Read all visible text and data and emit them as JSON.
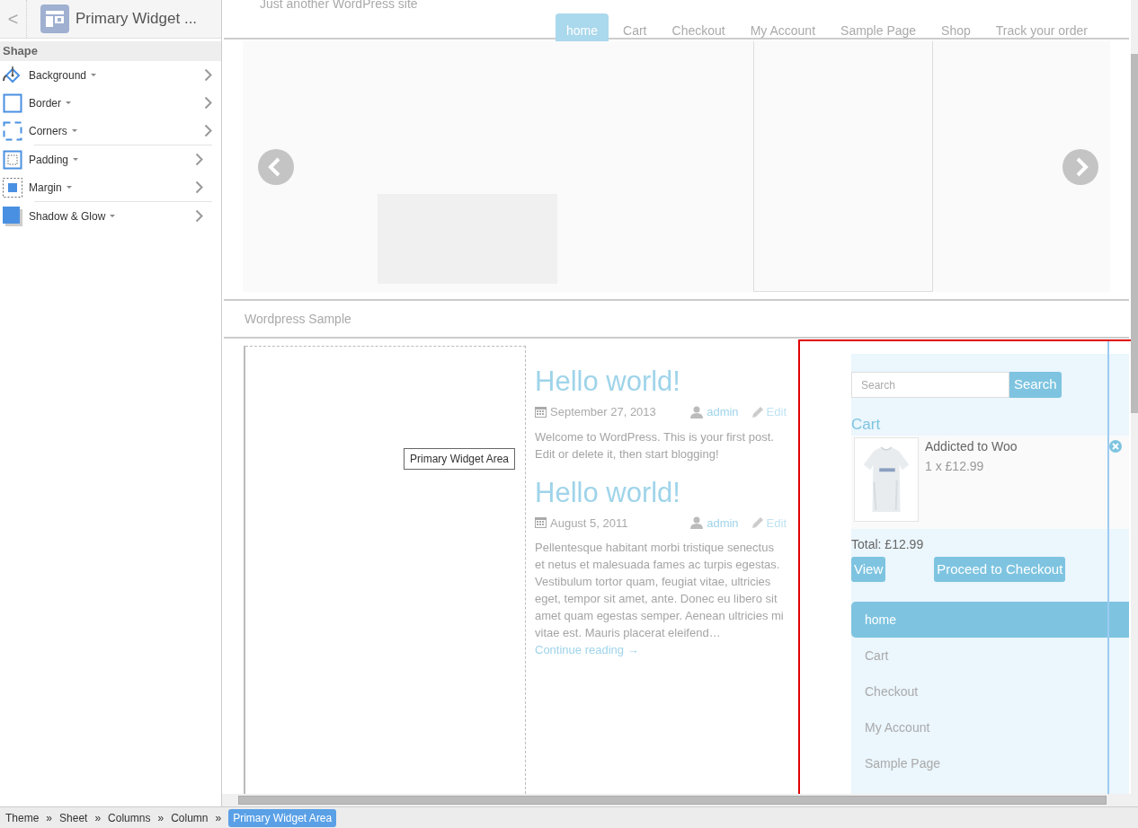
{
  "panel": {
    "back": "<",
    "title": "Primary Widget ...",
    "section": "Shape",
    "groups": [
      [
        {
          "label": "Background",
          "kind": "background"
        },
        {
          "label": "Border",
          "kind": "border"
        },
        {
          "label": "Corners",
          "kind": "corners"
        }
      ],
      [
        {
          "label": "Padding",
          "kind": "padding"
        },
        {
          "label": "Margin",
          "kind": "margin"
        }
      ],
      [
        {
          "label": "Shadow & Glow",
          "kind": "shadow"
        }
      ]
    ]
  },
  "site": {
    "tagline": "Just another WordPress site",
    "nav": [
      {
        "label": "home",
        "selected": true
      },
      {
        "label": "Cart",
        "selected": false
      },
      {
        "label": "Checkout",
        "selected": false
      },
      {
        "label": "My Account",
        "selected": false
      },
      {
        "label": "Sample Page",
        "selected": false
      },
      {
        "label": "Shop",
        "selected": false
      },
      {
        "label": "Track your order",
        "selected": false
      }
    ],
    "section_title": "Wordpress Sample",
    "posts": [
      {
        "title": "Hello world!",
        "date": "September 27, 2013",
        "author": "admin",
        "edit": "Edit",
        "excerpt": "Welcome to WordPress. This is your first post. Edit or delete it, then start blogging!"
      },
      {
        "title": "Hello world!",
        "date": "August 5, 2011",
        "author": "admin",
        "edit": "Edit",
        "excerpt": "Pellentesque habitant morbi tristique senectus et netus et malesuada fames ac turpis egestas. Vestibulum tortor quam, feugiat vitae, ultricies eget, tempor sit amet, ante. Donec eu libero sit amet quam egestas semper. Aenean ultricies mi vitae est. Mauris placerat eleifend…",
        "link": "Continue reading →"
      }
    ],
    "widget": {
      "search": {
        "placeholder": "Search",
        "button": "Search"
      },
      "cart": {
        "title": "Cart",
        "items": [
          {
            "name": "Addicted to Woo",
            "qty": "1 x £12.99"
          }
        ],
        "total": "Total: £12.99",
        "buttons": [
          "View",
          "Proceed to Checkout"
        ]
      },
      "menu": [
        {
          "label": "home",
          "selected": true
        },
        {
          "label": "Cart",
          "selected": false
        },
        {
          "label": "Checkout",
          "selected": false
        },
        {
          "label": "My Account",
          "selected": false
        },
        {
          "label": "Sample Page",
          "selected": false
        }
      ]
    },
    "tooltip": "Primary Widget Area"
  },
  "breadcrumb": [
    {
      "label": "Theme",
      "selected": false,
      "separator": "»"
    },
    {
      "label": "Sheet",
      "selected": false,
      "separator": "»"
    },
    {
      "label": "Columns",
      "selected": false,
      "separator": "»"
    },
    {
      "label": "Column",
      "selected": false,
      "separator": "»"
    },
    {
      "label": "Primary Widget Area",
      "selected": true
    }
  ]
}
